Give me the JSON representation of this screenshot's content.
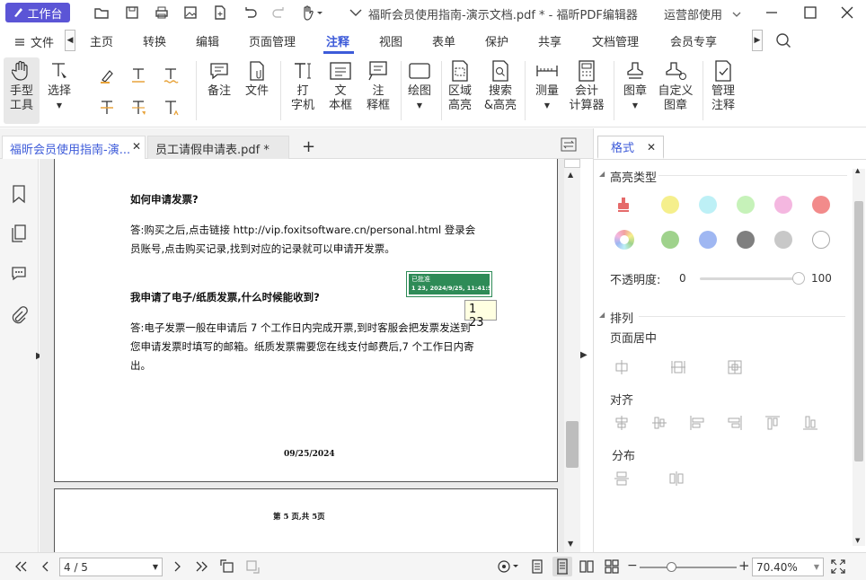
{
  "titlebar": {
    "workbench": "工作台",
    "title": "福昕会员使用指南-演示文档.pdf * - 福昕PDF编辑器",
    "account": "运营部使用"
  },
  "menu": {
    "file": "文件",
    "items": [
      "主页",
      "转换",
      "编辑",
      "页面管理",
      "注释",
      "视图",
      "表单",
      "保护",
      "共享",
      "文档管理",
      "会员专享"
    ],
    "active": "注释"
  },
  "ribbon": {
    "hand_tool": "手型\n工具",
    "select": "选择",
    "note": "备注",
    "file": "文件",
    "typewriter": "打\n字机",
    "textbox": "文\n本框",
    "callout": "注\n释框",
    "drawing": "绘图",
    "area_highlight": "区域\n高亮",
    "search_highlight": "搜索\n&高亮",
    "measure": "测量",
    "accounting": "会计\n计算器",
    "stamp": "图章",
    "custom_stamp": "自定义\n图章",
    "manage_comments": "管理\n注释"
  },
  "doctabs": {
    "tab1": "福昕会员使用指南-演...",
    "tab2": "员工请假申请表.pdf *",
    "add": "+"
  },
  "document": {
    "q1": "如何申请发票?",
    "a1_line1": "答:购买之后,点击链接 http://vip.foxitsoftware.cn/personal.html 登录会",
    "a1_line2": "员账号,点击购买记录,找到对应的记录就可以申请开发票。",
    "q2": "我申请了电子/纸质发票,什么时候能收到?",
    "a2_line1": "答:电子发票一般在申请后 7 个工作日内完成开票,到时客服会把发票发送到",
    "a2_line2": "您申请发票时填写的邮箱。纸质发票需要您在线支付邮费后,7 个工作日内寄",
    "a2_line3": "出。",
    "date": "09/25/2024",
    "page_footer": "第 5 页,共 5页",
    "stamp_title": "已批准",
    "stamp_detail": "1 23, 2024/9/25, 11:41:59",
    "tooltip": "1 23"
  },
  "rightpanel": {
    "tab": "格式",
    "highlight_type": "高亮类型",
    "opacity_label": "不透明度:",
    "opacity_min": "0",
    "opacity_max": "100",
    "opacity_value": 1.0,
    "arrange": "排列",
    "page_center": "页面居中",
    "align": "对齐",
    "distribute": "分布",
    "swatch_colors": [
      "#f5ef8c",
      "#bdf0f6",
      "#c6f2b9",
      "#f4b7e0",
      "#f28b8b",
      "#9fd28c",
      "#9fb7f2",
      "#7f7f7f",
      "#c8c8c8",
      "#ffffff"
    ]
  },
  "bottombar": {
    "page_value": "4 / 5",
    "zoom_value": "70.40%"
  }
}
